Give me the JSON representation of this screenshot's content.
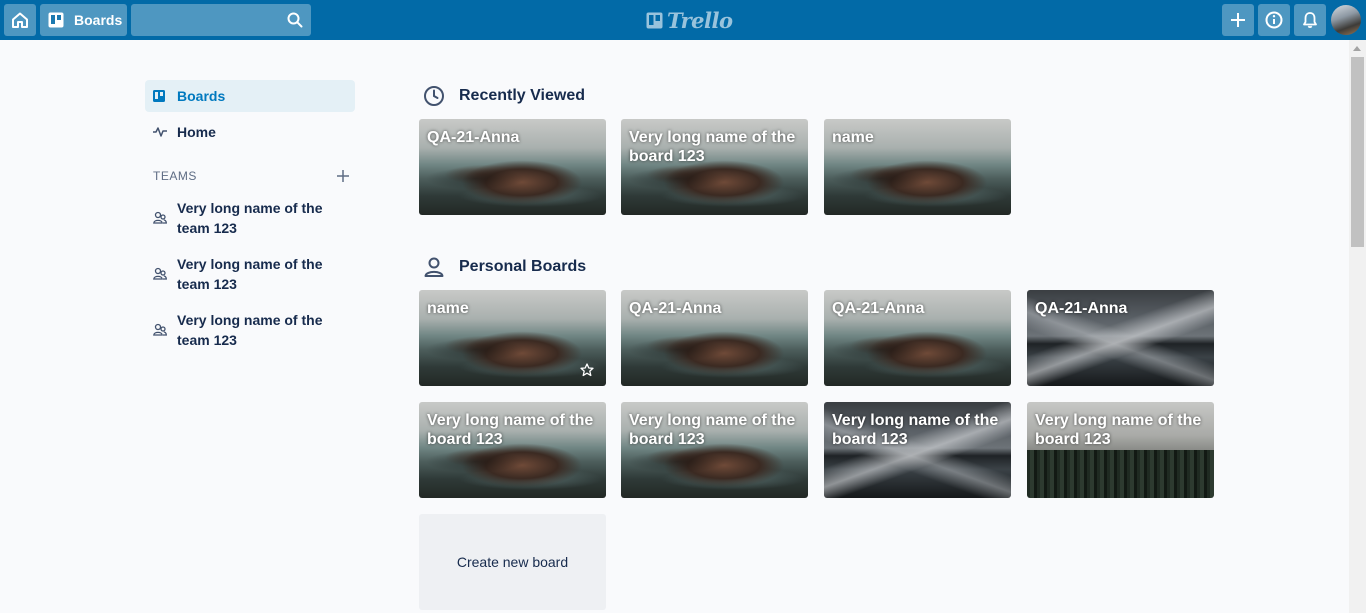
{
  "header": {
    "boards_label": "Boards",
    "logo_text": "Trello",
    "search_value": ""
  },
  "sidebar": {
    "boards_label": "Boards",
    "home_label": "Home",
    "teams_heading": "TEAMS",
    "teams": [
      {
        "name": "Very long name of the team 123"
      },
      {
        "name": "Very long name of the team 123"
      },
      {
        "name": "Very long name of the team 123"
      }
    ]
  },
  "recently_viewed": {
    "title": "Recently Viewed",
    "boards": [
      {
        "name": "QA-21-Anna",
        "background": "coast"
      },
      {
        "name": "Very long name of the board 123",
        "background": "coast"
      },
      {
        "name": "name",
        "background": "coast"
      }
    ]
  },
  "personal_boards": {
    "title": "Personal Boards",
    "boards": [
      {
        "name": "name",
        "background": "coast",
        "star_icon": "star-outline-icon"
      },
      {
        "name": "QA-21-Anna",
        "background": "coast"
      },
      {
        "name": "QA-21-Anna",
        "background": "coast"
      },
      {
        "name": "QA-21-Anna",
        "background": "lake"
      },
      {
        "name": "Very long name of the board 123",
        "background": "coast"
      },
      {
        "name": "Very long name of the board 123",
        "background": "coast"
      },
      {
        "name": "Very long name of the board 123",
        "background": "lake"
      },
      {
        "name": "Very long name of the board 123",
        "background": "forest"
      }
    ],
    "create_label": "Create new board"
  },
  "colors": {
    "header_bg": "#026aa7",
    "active_nav_bg": "#e4f0f6",
    "active_nav_text": "#0079bf",
    "text": "#172b4d",
    "muted": "#5e6c84",
    "create_tile_bg": "#eef0f3"
  }
}
